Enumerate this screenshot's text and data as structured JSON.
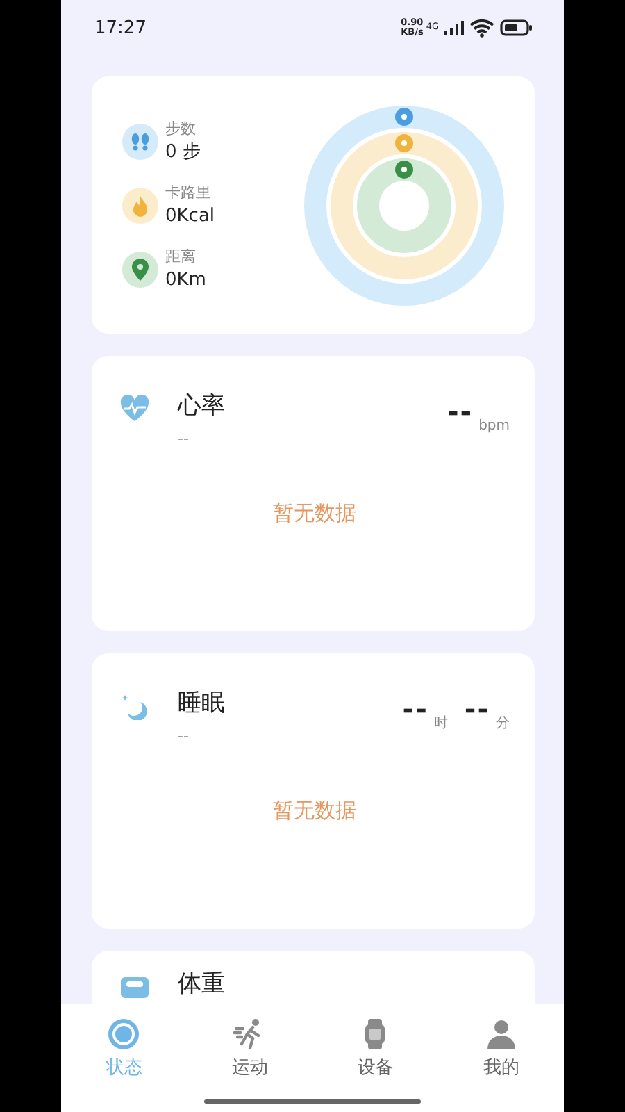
{
  "status_bar": {
    "time": "17:27",
    "speed_value": "0.90",
    "speed_unit": "KB/s",
    "network": "4G"
  },
  "summary": {
    "stats": [
      {
        "kind": "steps",
        "label": "步数",
        "value": "0 步"
      },
      {
        "kind": "calories",
        "label": "卡路里",
        "value": "0Kcal"
      },
      {
        "kind": "distance",
        "label": "距离",
        "value": "0Km"
      }
    ]
  },
  "cards": [
    {
      "kind": "heart",
      "title": "心率",
      "subtitle": "--",
      "readings": [
        {
          "value": "--",
          "unit": "bpm"
        }
      ],
      "empty_text": "暂无数据"
    },
    {
      "kind": "sleep",
      "title": "睡眠",
      "subtitle": "--",
      "readings": [
        {
          "value": "--",
          "unit": "时"
        },
        {
          "value": "--",
          "unit": "分"
        }
      ],
      "empty_text": "暂无数据"
    },
    {
      "kind": "weight",
      "title": "体重"
    }
  ],
  "tabs": [
    {
      "kind": "status",
      "label": "状态",
      "selected": true
    },
    {
      "kind": "sport",
      "label": "运动",
      "selected": false
    },
    {
      "kind": "device",
      "label": "设备",
      "selected": false
    },
    {
      "kind": "profile",
      "label": "我的",
      "selected": false
    }
  ]
}
